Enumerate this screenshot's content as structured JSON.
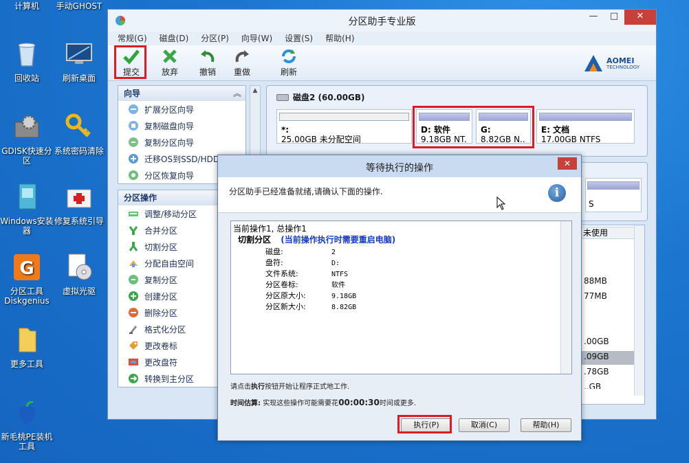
{
  "desktop": {
    "icons": [
      {
        "label": "计算机"
      },
      {
        "label": "手动GHOST"
      },
      {
        "label": "回收站"
      },
      {
        "label": "刷新桌面"
      },
      {
        "label": "GDISK快速分区"
      },
      {
        "label": "系统密码清除"
      },
      {
        "label": "Windows安装器"
      },
      {
        "label": "修复系统引导"
      },
      {
        "label": "分区工具Diskgenius"
      },
      {
        "label": "虚拟光驱"
      },
      {
        "label": "更多工具"
      },
      {
        "label": "新毛桃PE装机工具"
      }
    ]
  },
  "window": {
    "title": "分区助手专业版",
    "menu": [
      "常规(G)",
      "磁盘(D)",
      "分区(P)",
      "向导(W)",
      "设置(S)",
      "帮助(H)"
    ],
    "toolbar": {
      "commit": "提交",
      "discard": "放弃",
      "undo": "撤销",
      "redo": "重做",
      "refresh": "刷新"
    },
    "brand": {
      "name": "AOMEI",
      "sub": "TECHNOLOGY"
    }
  },
  "wizard_panel": {
    "title": "向导",
    "items": [
      "扩展分区向导",
      "复制磁盘向导",
      "复制分区向导",
      "迁移OS到SSD/HDD",
      "分区恢复向导"
    ]
  },
  "ops_panel": {
    "title": "分区操作",
    "items": [
      "调整/移动分区",
      "合并分区",
      "切割分区",
      "分配自由空间",
      "复制分区",
      "创建分区",
      "删除分区",
      "格式化分区",
      "更改卷标",
      "更改盘符",
      "转换到主分区"
    ]
  },
  "disk": {
    "title": "磁盘2 (60.00GB)",
    "partitions": [
      {
        "name": "*:",
        "size": "25.00GB 未分配空间"
      },
      {
        "name": "D: 软件",
        "size": "9.18GB NT..."
      },
      {
        "name": "G:",
        "size": "8.82GB N..."
      },
      {
        "name": "E: 文档",
        "size": "17.00GB NTFS"
      }
    ]
  },
  "right_fragment": {
    "s_text": "S",
    "col_header": "未使用",
    "cells": [
      "88MB",
      "77MB",
      ".00GB",
      ".09GB",
      ".78GB",
      "..GB"
    ]
  },
  "dialog": {
    "title": "等待执行的操作",
    "close": "✕",
    "message": "分区助手已经准备就绪,请确认下面的操作.",
    "op_header": "当前操作1, 总操作1",
    "op_name": "切割分区",
    "op_note": "(当前操作执行时需要重启电脑)",
    "details": [
      {
        "k": "磁盘:",
        "v": "2"
      },
      {
        "k": "盘符:",
        "v": "D:"
      },
      {
        "k": "文件系统:",
        "v": "NTFS"
      },
      {
        "k": "分区卷标:",
        "v": "软件"
      },
      {
        "k": "分区原大小:",
        "v": "9.18GB"
      },
      {
        "k": "分区新大小:",
        "v": "8.82GB"
      }
    ],
    "hint_pre": "请点击",
    "hint_bold": "执行",
    "hint_post": "按钮开始让程序正式地工作.",
    "est_label": "时间估算:",
    "est_pre": "实现这些操作可能需要花",
    "est_time": "00:00:30",
    "est_post": "时间或更多.",
    "buttons": {
      "execute": "执行(P)",
      "cancel": "取消(C)",
      "help": "帮助(H)"
    }
  }
}
